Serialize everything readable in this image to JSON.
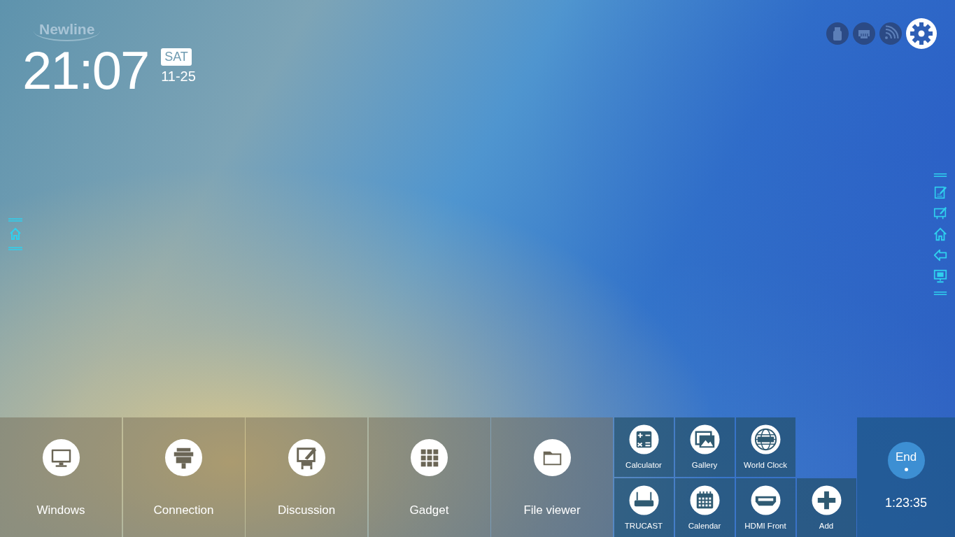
{
  "logo": "Newline",
  "clock": {
    "time": "21:07",
    "day": "SAT",
    "date": "11-25"
  },
  "dock": [
    {
      "label": "Windows"
    },
    {
      "label": "Connection"
    },
    {
      "label": "Discussion"
    },
    {
      "label": "Gadget"
    },
    {
      "label": "File viewer"
    }
  ],
  "small_apps": [
    [
      {
        "label": "Calculator"
      },
      {
        "label": "Gallery"
      },
      {
        "label": "World Clock"
      }
    ],
    [
      {
        "label": "TRUCAST"
      },
      {
        "label": "Calendar"
      },
      {
        "label": "HDMI Front"
      },
      {
        "label": "Add"
      }
    ]
  ],
  "end_panel": {
    "button": "End",
    "timer": "1:23:35"
  }
}
